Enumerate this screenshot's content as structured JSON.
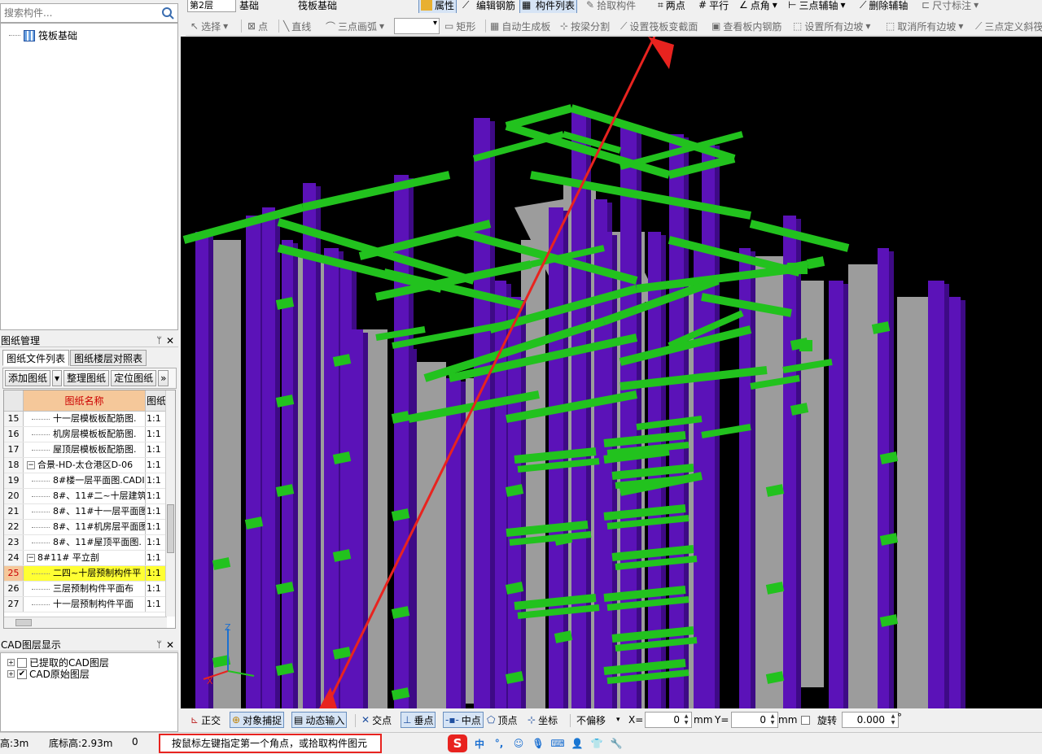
{
  "search": {
    "placeholder": "搜索构件..."
  },
  "component_tree": {
    "root_label": "筏板基础"
  },
  "drawing_panel": {
    "title": "图纸管理",
    "tabs": [
      "图纸文件列表",
      "图纸楼层对照表"
    ],
    "buttons": {
      "add": "添加图纸",
      "organize": "整理图纸",
      "locate": "定位图纸",
      "more": "»"
    },
    "columns": {
      "name": "图纸名称",
      "scale": "图纸"
    },
    "rows": [
      {
        "num": "15",
        "name": "十一层模板板配筋图.",
        "scale": "1:1",
        "level": 2,
        "expander": ""
      },
      {
        "num": "16",
        "name": "机房层模板板配筋图.",
        "scale": "1:1",
        "level": 2,
        "expander": ""
      },
      {
        "num": "17",
        "name": "屋顶层模板板配筋图.",
        "scale": "1:1",
        "level": 2,
        "expander": ""
      },
      {
        "num": "18",
        "name": "合景-HD-太仓港区D-06",
        "scale": "1:1",
        "level": 1,
        "expander": "−"
      },
      {
        "num": "19",
        "name": "8#楼一层平面图.CADI",
        "scale": "1:1",
        "level": 2,
        "expander": ""
      },
      {
        "num": "20",
        "name": "8#、11#二~十层建筑",
        "scale": "1:1",
        "level": 2,
        "expander": ""
      },
      {
        "num": "21",
        "name": "8#、11#十一层平面图",
        "scale": "1:1",
        "level": 2,
        "expander": ""
      },
      {
        "num": "22",
        "name": "8#、11#机房层平面图",
        "scale": "1:1",
        "level": 2,
        "expander": ""
      },
      {
        "num": "23",
        "name": "8#、11#屋顶平面图.",
        "scale": "1:1",
        "level": 2,
        "expander": ""
      },
      {
        "num": "24",
        "name": "8#11# 平立剖",
        "scale": "1:1",
        "level": 1,
        "expander": "−"
      },
      {
        "num": "25",
        "name": "二四~十层预制构件平",
        "scale": "1:1",
        "level": 2,
        "expander": "",
        "highlight": true
      },
      {
        "num": "26",
        "name": "三层预制构件平面布",
        "scale": "1:1",
        "level": 2,
        "expander": ""
      },
      {
        "num": "27",
        "name": "十一层预制构件平面",
        "scale": "1:1",
        "level": 2,
        "expander": ""
      }
    ]
  },
  "cad_panel": {
    "title": "CAD图层显示",
    "items": [
      {
        "label": "已提取的CAD图层",
        "checked": false
      },
      {
        "label": "CAD原始图层",
        "checked": true
      }
    ]
  },
  "toolbar_top": {
    "floor": "第2层",
    "category": "基础",
    "type": "筏板基础",
    "items": [
      "属性",
      "编辑钢筋",
      "构件列表",
      "拾取构件",
      "两点",
      "平行",
      "点角",
      "三点辅轴",
      "删除辅轴",
      "尺寸标注"
    ]
  },
  "toolbar_draw": {
    "items": [
      "选择",
      "点",
      "直线",
      "三点画弧",
      "矩形",
      "自动生成板",
      "按梁分割",
      "设置筏板变截面",
      "查看板内钢筋",
      "设置所有边坡",
      "取消所有边坡",
      "三点定义斜筏"
    ]
  },
  "toolbar_bottom": {
    "ortho": "正交",
    "snap": "对象捕捉",
    "dyn": "动态输入",
    "intersect": "交点",
    "perp": "垂点",
    "mid": "中点",
    "vertex": "顶点",
    "coord": "坐标",
    "offset_mode": "不偏移",
    "x_label": "X=",
    "x_value": "0",
    "unit1": "mm",
    "y_label": "Y=",
    "y_value": "0",
    "unit2": "mm",
    "rotate_label": "旋转",
    "rotate_value": "0.000",
    "degree": "°"
  },
  "status": {
    "height": "高:3m",
    "base_height": "底标高:2.93m",
    "count": "0",
    "message": "按鼠标左键指定第一个角点，或拾取构件图元"
  },
  "ime": {
    "lang": "中",
    "punct": "°,"
  },
  "colors": {
    "viewport_bg": "#000000",
    "beam_green": "#22c21e",
    "column_purple": "#5b12b8",
    "wall_gray": "#9c9c9c",
    "annotation_red": "#e8231f",
    "highlight_yellow": "#ffff33"
  }
}
